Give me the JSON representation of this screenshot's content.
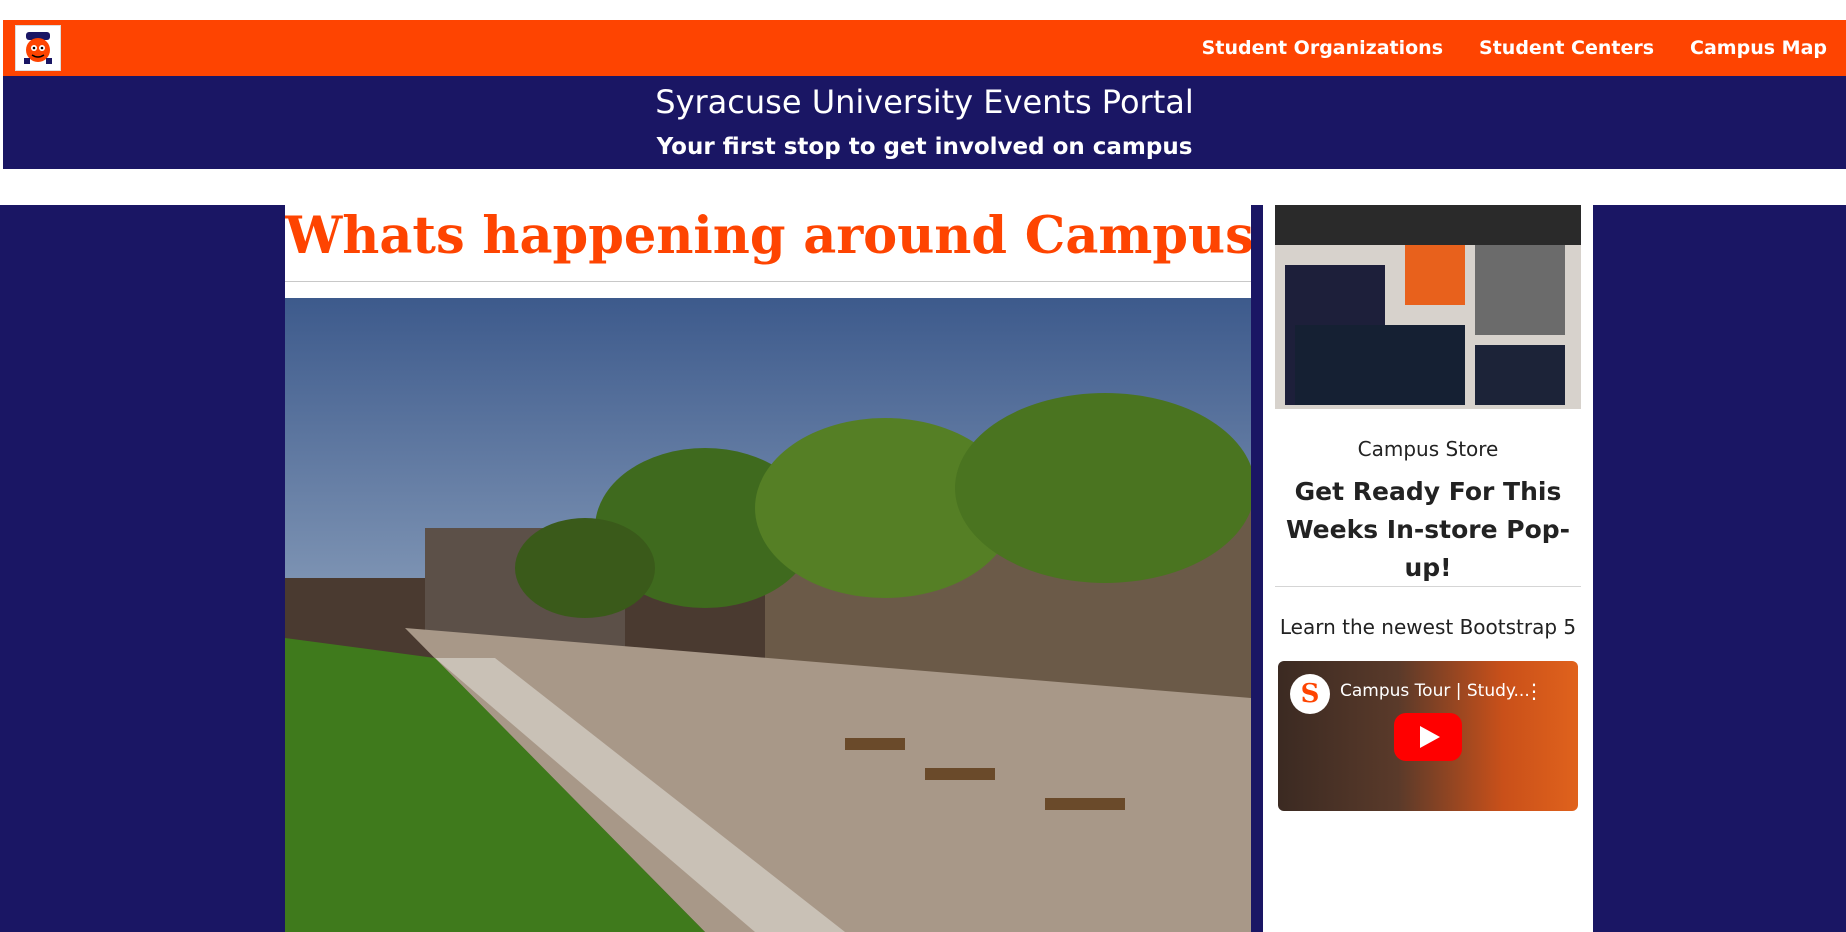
{
  "nav": {
    "logo_icon": "otto-mascot-icon",
    "links": [
      "Student Organizations",
      "Student Centers",
      "Campus Map"
    ]
  },
  "banner": {
    "title": "Syracuse University Events Portal",
    "subtitle": "Your first stop to get involved on campus"
  },
  "main": {
    "headline": "Whats happening around Campus?"
  },
  "sidebar": {
    "store_label": "Campus Store",
    "store_headline": "Get Ready For This Weeks In-store Pop-up!",
    "video_label": "Learn the newest Bootstrap 5",
    "video_title": "Campus Tour | Study..."
  },
  "colors": {
    "orange": "#FE4401",
    "navy": "#1A1664"
  }
}
